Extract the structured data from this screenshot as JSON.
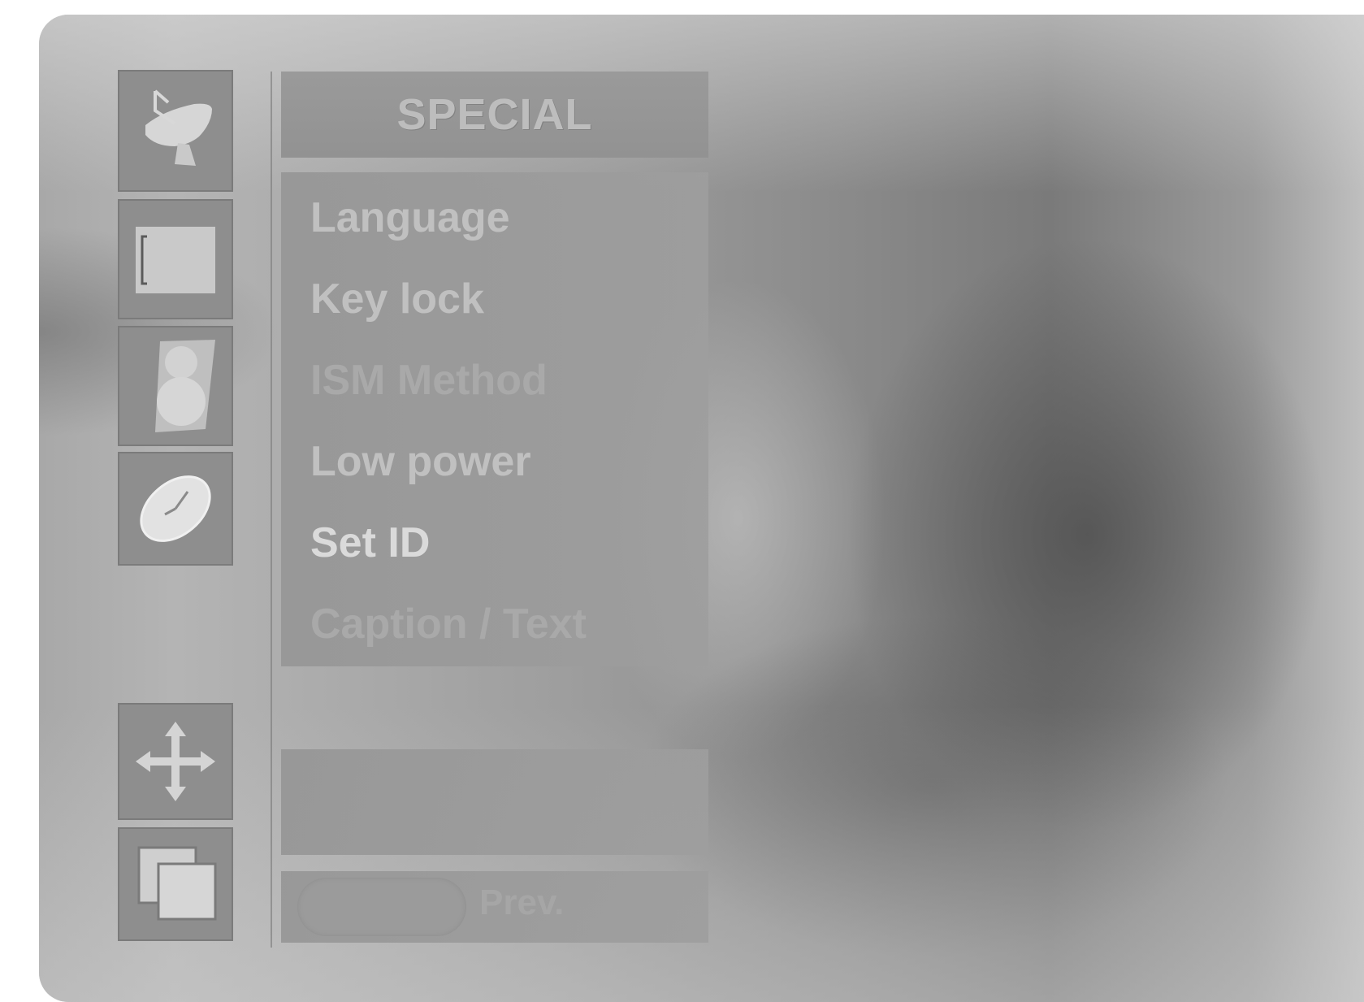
{
  "menu": {
    "title": "SPECIAL",
    "items": [
      {
        "label": "Language"
      },
      {
        "label": "Key lock"
      },
      {
        "label": "ISM Method"
      },
      {
        "label": "Low power"
      },
      {
        "label": "Set ID"
      },
      {
        "label": "Caption / Text"
      }
    ],
    "selected_index": 4
  },
  "nav": {
    "prev_label": "Prev."
  },
  "side_icons": [
    "satellite-dish-icon",
    "screen-icon",
    "speaker-icon",
    "clock-icon",
    "move-arrows-icon",
    "pip-windows-icon"
  ]
}
